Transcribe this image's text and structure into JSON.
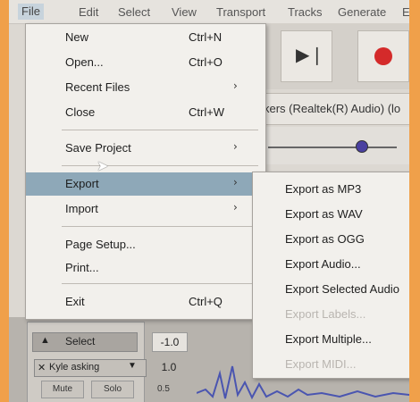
{
  "menubar": {
    "items": [
      "File",
      "Edit",
      "Select",
      "View",
      "Transport",
      "Tracks",
      "Generate",
      "E"
    ]
  },
  "file_menu": {
    "items": [
      {
        "label": "New",
        "shortcut": "Ctrl+N"
      },
      {
        "label": "Open...",
        "shortcut": "Ctrl+O"
      },
      {
        "label": "Recent Files",
        "submenu_arrow": "›"
      },
      {
        "label": "Close",
        "shortcut": "Ctrl+W"
      },
      {
        "label": "Save Project",
        "submenu_arrow": "›"
      },
      {
        "label": "Export",
        "submenu_arrow": "›"
      },
      {
        "label": "Import",
        "submenu_arrow": "›"
      },
      {
        "label": "Page Setup..."
      },
      {
        "label": "Print..."
      },
      {
        "label": "Exit",
        "shortcut": "Ctrl+Q"
      }
    ]
  },
  "export_submenu": {
    "items": [
      {
        "label": "Export as MP3",
        "enabled": true
      },
      {
        "label": "Export as WAV",
        "enabled": true
      },
      {
        "label": "Export as OGG",
        "enabled": true
      },
      {
        "label": "Export Audio...",
        "enabled": true
      },
      {
        "label": "Export Selected Audio",
        "enabled": true
      },
      {
        "label": "Export Labels...",
        "enabled": false
      },
      {
        "label": "Export Multiple...",
        "enabled": true
      },
      {
        "label": "Export MIDI...",
        "enabled": false
      }
    ]
  },
  "device": {
    "output_label": "kers (Realtek(R) Audio) (lo"
  },
  "track": {
    "select_label": "Select",
    "name": "Kyle asking",
    "mute_label": "Mute",
    "solo_label": "Solo",
    "scale_top": "-1.0",
    "scale_mid": "1.0",
    "scale_low": "0.5"
  },
  "icons": {
    "skip_end": "skip-to-end-icon",
    "record": "record-icon"
  },
  "colors": {
    "frame": "#f0a04a",
    "highlight": "#8ea8b8",
    "record": "#d42a2a"
  }
}
